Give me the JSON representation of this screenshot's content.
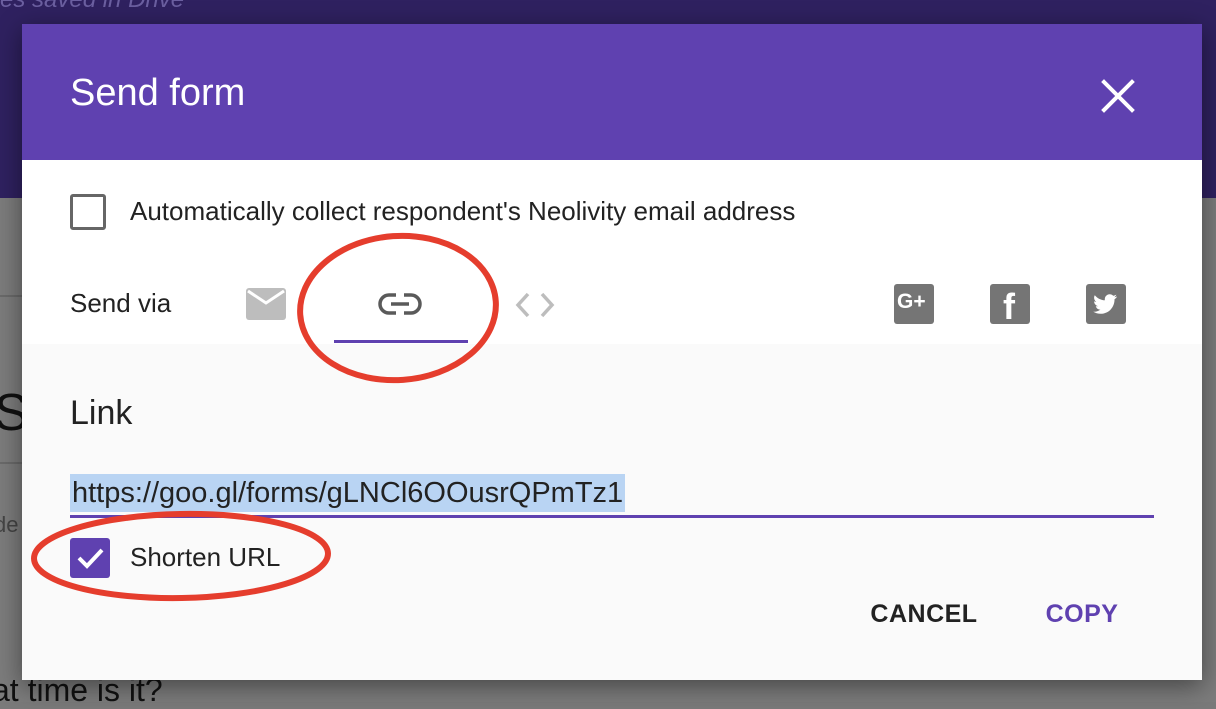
{
  "background": {
    "status_text": "es saved in Drive",
    "question_text": "at time is it?",
    "heading_fragment": "S",
    "fragment": "de"
  },
  "dialog": {
    "title": "Send form",
    "close_icon": "close-icon",
    "collect_email": {
      "label": "Automatically collect respondent's Neolivity email address",
      "checked": false
    },
    "send_via": {
      "label": "Send via",
      "options": [
        {
          "name": "email",
          "icon": "mail-icon",
          "selected": false
        },
        {
          "name": "link",
          "icon": "link-icon",
          "selected": true
        },
        {
          "name": "embed",
          "icon": "embed-icon",
          "selected": false
        }
      ],
      "social": [
        {
          "name": "google-plus",
          "icon": "google-plus-icon",
          "glyph": "G+"
        },
        {
          "name": "facebook",
          "icon": "facebook-icon",
          "glyph": "f"
        },
        {
          "name": "twitter",
          "icon": "twitter-icon"
        }
      ]
    },
    "link": {
      "heading": "Link",
      "url": "https://goo.gl/forms/gLNCl6OOusrQPmTz1",
      "shorten_url": {
        "label": "Shorten URL",
        "checked": true
      }
    },
    "actions": {
      "cancel_label": "CANCEL",
      "copy_label": "COPY"
    }
  },
  "colors": {
    "accent": "#5f41b0",
    "annotation": "#e53d2d",
    "highlight": "#b9d4f3"
  }
}
